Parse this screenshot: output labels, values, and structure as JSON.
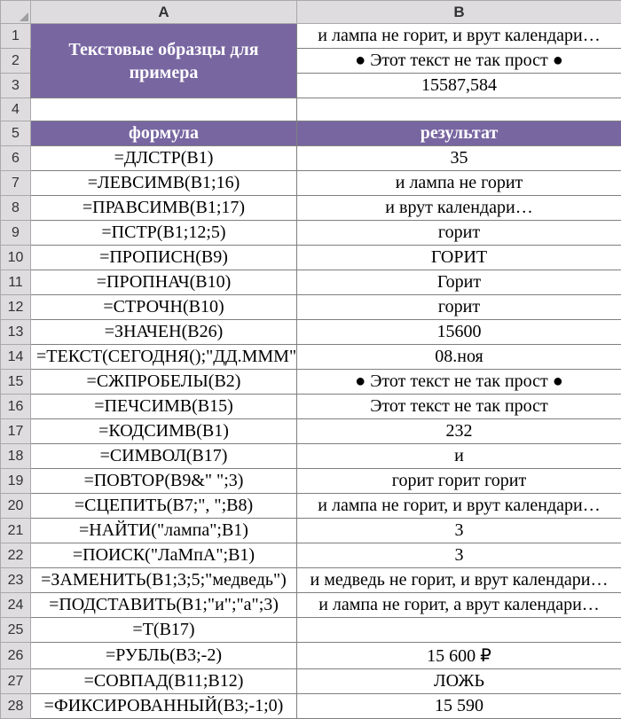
{
  "columns": {
    "A": "A",
    "B": "B"
  },
  "rowNumbers": [
    "1",
    "2",
    "3",
    "4",
    "5",
    "6",
    "7",
    "8",
    "9",
    "10",
    "11",
    "12",
    "13",
    "14",
    "15",
    "16",
    "17",
    "18",
    "19",
    "20",
    "21",
    "22",
    "23",
    "24",
    "25",
    "26",
    "27",
    "28"
  ],
  "mergedHeader": "Текстовые образцы для примера",
  "b1": "и лампа не горит, и врут календари…",
  "b2": "●   Этот текст не так прост  ●",
  "b3": "15587,584",
  "header5a": "формула",
  "header5b": "результат",
  "rows": [
    {
      "a": "=ДЛСТР(B1)",
      "b": "35"
    },
    {
      "a": "=ЛЕВСИМВ(B1;16)",
      "b": "и лампа не горит"
    },
    {
      "a": "=ПРАВСИМВ(B1;17)",
      "b": "и врут календари…"
    },
    {
      "a": "=ПСТР(B1;12;5)",
      "b": "горит"
    },
    {
      "a": "=ПРОПИСН(B9)",
      "b": "ГОРИТ"
    },
    {
      "a": "=ПРОПНАЧ(B10)",
      "b": "Горит"
    },
    {
      "a": "=СТРОЧН(B10)",
      "b": "горит"
    },
    {
      "a": "=ЗНАЧЕН(B26)",
      "b": "15600"
    },
    {
      "a": "=ТЕКСТ(СЕГОДНЯ();\"ДД.МММ\")",
      "b": "08.ноя"
    },
    {
      "a": "=СЖПРОБЕЛЫ(B2)",
      "b": "● Этот текст не так прост ●"
    },
    {
      "a": "=ПЕЧСИМВ(B15)",
      "b": "Этот текст не так прост"
    },
    {
      "a": "=КОДСИМВ(B1)",
      "b": "232"
    },
    {
      "a": "=СИМВОЛ(B17)",
      "b": "и"
    },
    {
      "a": "=ПОВТОР(B9&\" \";3)",
      "b": "горит горит горит"
    },
    {
      "a": "=СЦЕПИТЬ(B7;\", \";B8)",
      "b": "и лампа не горит, и врут календари…"
    },
    {
      "a": "=НАЙТИ(\"лампа\";B1)",
      "b": "3"
    },
    {
      "a": "=ПОИСК(\"ЛаМпА\";B1)",
      "b": "3"
    },
    {
      "a": "=ЗАМЕНИТЬ(B1;3;5;\"медведь\")",
      "b": "и медведь не горит, и врут календари…"
    },
    {
      "a": "=ПОДСТАВИТЬ(B1;\"и\";\"а\";3)",
      "b": "и лампа не горит, а врут календари…"
    },
    {
      "a": "=Т(B17)",
      "b": ""
    },
    {
      "a": "=РУБЛЬ(B3;-2)",
      "b": "15 600 ₽"
    },
    {
      "a": "=СОВПАД(B11;B12)",
      "b": "ЛОЖЬ"
    },
    {
      "a": "=ФИКСИРОВАННЫЙ(B3;-1;0)",
      "b": "15 590"
    }
  ],
  "chart_data": {
    "type": "table",
    "title": "Excel text functions example",
    "columns": [
      "формула",
      "результат"
    ],
    "samples": {
      "B1": "и лампа не горит, и врут календари…",
      "B2": "●   Этот текст не так прост  ●",
      "B3": "15587,584"
    },
    "data": [
      [
        "=ДЛСТР(B1)",
        "35"
      ],
      [
        "=ЛЕВСИМВ(B1;16)",
        "и лампа не горит"
      ],
      [
        "=ПРАВСИМВ(B1;17)",
        "и врут календари…"
      ],
      [
        "=ПСТР(B1;12;5)",
        "горит"
      ],
      [
        "=ПРОПИСН(B9)",
        "ГОРИТ"
      ],
      [
        "=ПРОПНАЧ(B10)",
        "Горит"
      ],
      [
        "=СТРОЧН(B10)",
        "горит"
      ],
      [
        "=ЗНАЧЕН(B26)",
        "15600"
      ],
      [
        "=ТЕКСТ(СЕГОДНЯ();\"ДД.МММ\")",
        "08.ноя"
      ],
      [
        "=СЖПРОБЕЛЫ(B2)",
        "● Этот текст не так прост ●"
      ],
      [
        "=ПЕЧСИМВ(B15)",
        "Этот текст не так прост"
      ],
      [
        "=КОДСИМВ(B1)",
        "232"
      ],
      [
        "=СИМВОЛ(B17)",
        "и"
      ],
      [
        "=ПОВТОР(B9&\" \";3)",
        "горит горит горит"
      ],
      [
        "=СЦЕПИТЬ(B7;\", \";B8)",
        "и лампа не горит, и врут календари…"
      ],
      [
        "=НАЙТИ(\"лампа\";B1)",
        "3"
      ],
      [
        "=ПОИСК(\"ЛаМпА\";B1)",
        "3"
      ],
      [
        "=ЗАМЕНИТЬ(B1;3;5;\"медведь\")",
        "и медведь не горит, и врут календари…"
      ],
      [
        "=ПОДСТАВИТЬ(B1;\"и\";\"а\";3)",
        "и лампа не горит, а врут календари…"
      ],
      [
        "=Т(B17)",
        ""
      ],
      [
        "=РУБЛЬ(B3;-2)",
        "15 600 ₽"
      ],
      [
        "=СОВПАД(B11;B12)",
        "ЛОЖЬ"
      ],
      [
        "=ФИКСИРОВАННЫЙ(B3;-1;0)",
        "15 590"
      ]
    ]
  }
}
